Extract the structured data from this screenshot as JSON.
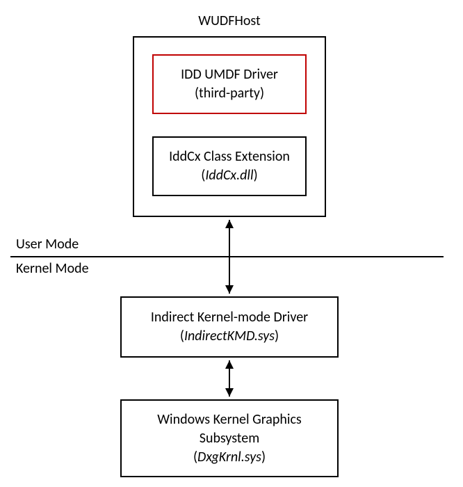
{
  "diagram": {
    "wudfhost_title": "WUDFHost",
    "idd_driver": {
      "line1": "IDD UMDF Driver",
      "line2": "(third-party)"
    },
    "iddcx_ext": {
      "line1": "IddCx Class Extension",
      "line2_prefix": "(",
      "line2_italic": "IddCx.dll",
      "line2_suffix": ")"
    },
    "user_mode_label": "User Mode",
    "kernel_mode_label": "Kernel Mode",
    "indirect_kmd": {
      "line1": "Indirect Kernel-mode Driver",
      "line2_prefix": "(",
      "line2_italic": "IndirectKMD.sys",
      "line2_suffix": ")"
    },
    "graphics_subsystem": {
      "line1": "Windows Kernel Graphics",
      "line2": "Subsystem",
      "line3_prefix": "(",
      "line3_italic": "DxgKrnl.sys",
      "line3_suffix": ")"
    }
  }
}
